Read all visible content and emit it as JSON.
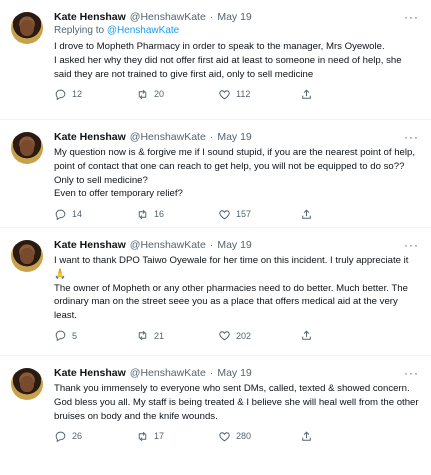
{
  "tweets": [
    {
      "name": "Kate Henshaw",
      "handle": "@HenshawKate",
      "dot": "·",
      "date": "May 19",
      "more": "···",
      "reply_prefix": "Replying to",
      "reply_to": "@HenshawKate",
      "lines": [
        "I drove to Mopheth Pharmacy in order to speak to the manager, Mrs Oyewole.",
        "I asked her why they did not offer first aid at least to someone in need of help, she said they are not trained to give first aid, only to sell medicine"
      ],
      "replies": "12",
      "retweets": "20",
      "likes": "112"
    },
    {
      "name": "Kate Henshaw",
      "handle": "@HenshawKate",
      "dot": "·",
      "date": "May 19",
      "more": "···",
      "lines": [
        "My question now is & forgive me if I sound stupid, if you are the nearest point of help, point of contact that one can reach to get help, you will not be equipped to do so?? Only to sell medicine?",
        "Even to offer temporary relief?"
      ],
      "replies": "14",
      "retweets": "16",
      "likes": "157"
    },
    {
      "name": "Kate Henshaw",
      "handle": "@HenshawKate",
      "dot": "·",
      "date": "May 19",
      "more": "···",
      "lines": [
        "I want to thank DPO Taiwo Oyewale for her time on this incident. I truly appreciate it 🙏",
        "The owner of Mopheth or any other pharmacies need to do better. Much better. The ordinary man on the street seee you as a place that offers medical aid at the very least."
      ],
      "replies": "5",
      "retweets": "21",
      "likes": "202"
    },
    {
      "name": "Kate Henshaw",
      "handle": "@HenshawKate",
      "dot": "·",
      "date": "May 19",
      "more": "···",
      "lines": [
        "Thank you immensely to everyone who sent DMs, called, texted & showed concern. God bless you all. My staff is being treated & I believe she will heal well from the other bruises on body and the knife wounds."
      ],
      "replies": "26",
      "retweets": "17",
      "likes": "280"
    }
  ]
}
